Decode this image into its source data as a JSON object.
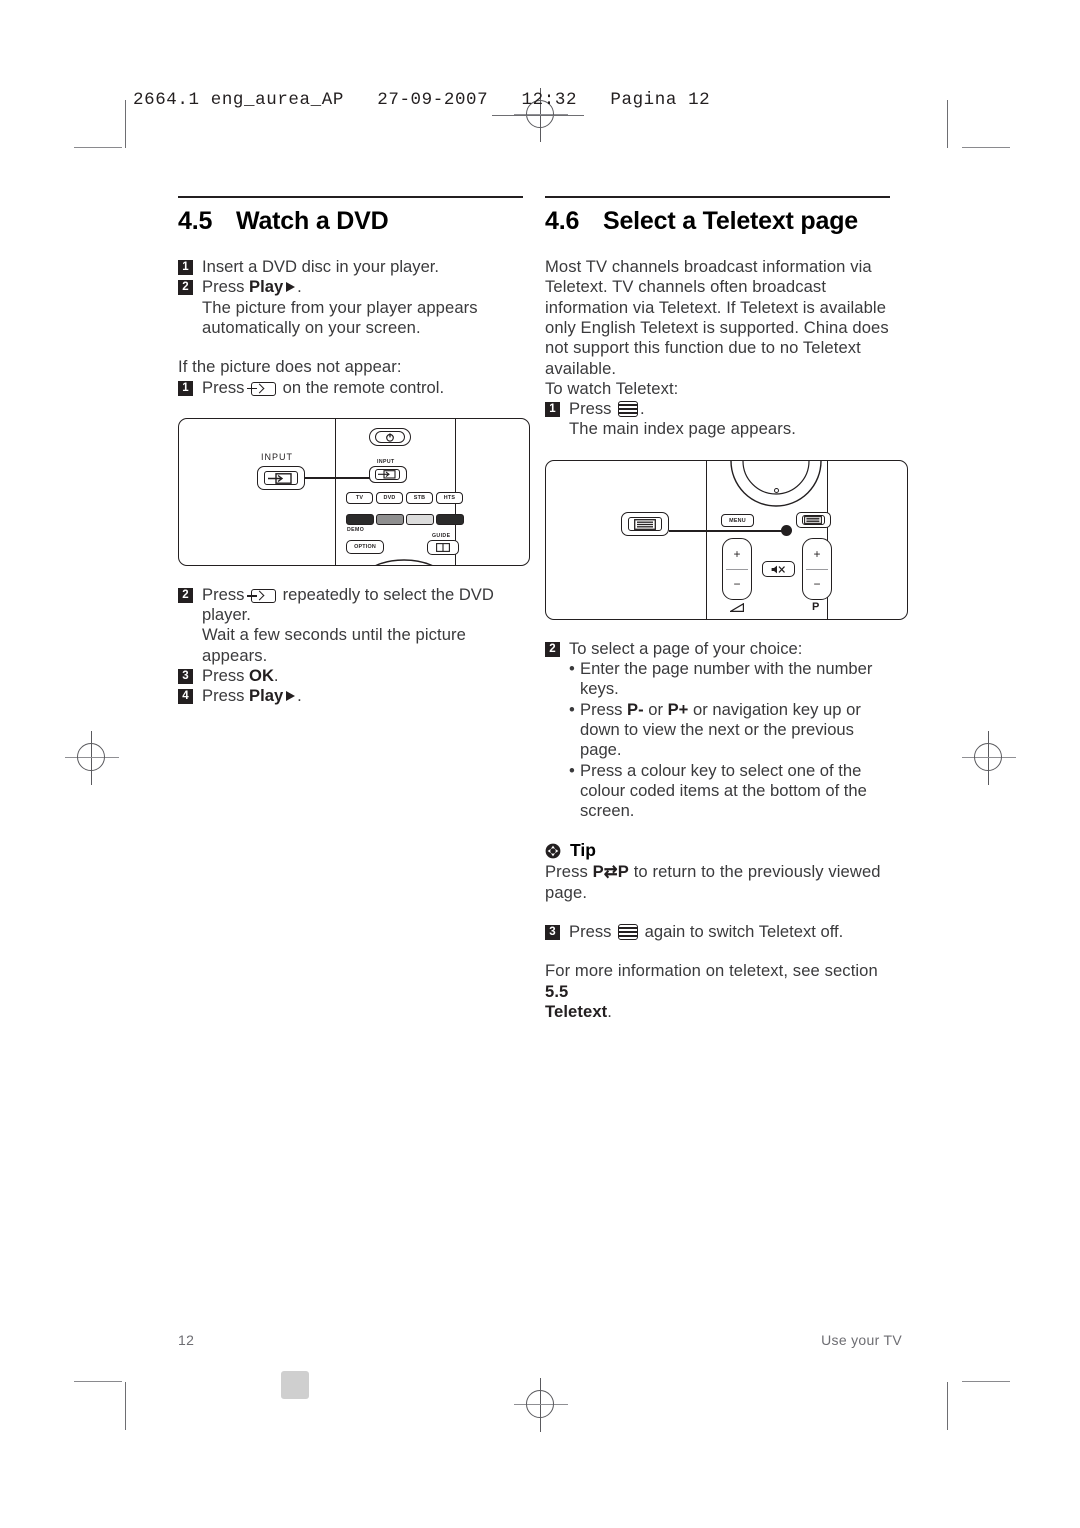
{
  "imposition": {
    "header_line": "2664.1 eng_aurea_AP   27-09-2007   12:32   Pagina 12"
  },
  "left_column": {
    "section_number": "4.5",
    "section_title": "Watch a DVD",
    "steps": [
      {
        "marker": "1",
        "text": "Insert a DVD disc in your player."
      },
      {
        "marker": "2",
        "text_before": "Press ",
        "bold": "Play",
        "text_after": "."
      }
    ],
    "step2_continuation": "The picture from your player appears automatically on your screen.",
    "fallback_intro": "If the picture does not appear:",
    "fallback_step": {
      "marker": "1",
      "text_before": "Press ",
      "text_after": " on the remote control."
    },
    "steps_after": [
      {
        "marker": "2",
        "text_before": "Press ",
        "text_after": " repeatedly to select the DVD player.",
        "continuation": "Wait a few seconds until the picture appears."
      },
      {
        "marker": "3",
        "text_before": "Press ",
        "bold": "OK",
        "text_after": "."
      },
      {
        "marker": "4",
        "text_before": "Press ",
        "bold": "Play",
        "text_after": "."
      }
    ],
    "diagram": {
      "callout_label": "INPUT",
      "input_label_small": "INPUT",
      "source_buttons": [
        "TV",
        "DVD",
        "STB",
        "HTS"
      ],
      "demo_label": "DEMO",
      "option_label": "OPTION",
      "guide_label": "GUIDE",
      "colorbars": [
        "#2b2b2b",
        "#8f8f8f",
        "#dcdcdc",
        "#2b2b2b"
      ]
    }
  },
  "right_column": {
    "section_number": "4.6",
    "section_title": "Select a Teletext page",
    "intro": "Most TV channels broadcast information via Teletext. TV channels often broadcast information via Teletext. If Teletext is available only English Teletext is supported. China does not support this function due to no Teletext available.",
    "intro_last_line": "To watch Teletext:",
    "step1": {
      "marker": "1",
      "text_before": "Press ",
      "text_after": ".",
      "continuation": "The main index page appears."
    },
    "diagram": {
      "menu_label": "MENU",
      "volume_label": "volume-icon",
      "program_label": "P",
      "plus": "+",
      "minus": "−"
    },
    "step2": {
      "marker": "2",
      "text": "To select a page of your choice:"
    },
    "bullets": [
      {
        "text": "Enter the page number with the number keys."
      },
      {
        "text_before": "Press ",
        "bold1": "P-",
        "text_mid": " or ",
        "bold2": "P+",
        "text_after": " or navigation key up or down to view the next or the previous page."
      },
      {
        "text": "Press a colour key to select one of the colour coded items at the bottom of the screen."
      }
    ],
    "tip": {
      "label": "Tip",
      "text_before": "Press ",
      "key_bold": "P⇄P",
      "text_after": " to return to the previously viewed page."
    },
    "step3": {
      "marker": "3",
      "text_before": "Press ",
      "text_after": " again to switch Teletext off."
    },
    "closing": {
      "text_before": "For more information on teletext, see section ",
      "bold1": "5.5",
      "bold2": "Teletext",
      "text_after": "."
    }
  },
  "footer": {
    "page_number": "12",
    "running_head": "Use your TV"
  }
}
